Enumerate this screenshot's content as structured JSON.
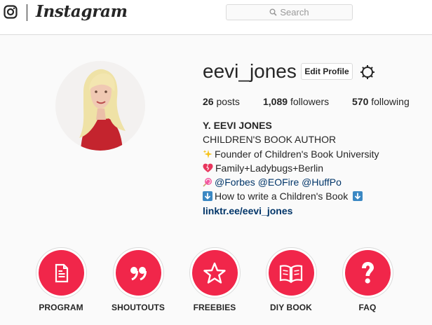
{
  "header": {
    "brand": "Instagram",
    "search_placeholder": "Search"
  },
  "profile": {
    "username": "eevi_jones",
    "edit_label": "Edit Profile",
    "posts_count": "26",
    "posts_label": "posts",
    "followers_count": "1,089",
    "followers_label": "followers",
    "following_count": "570",
    "following_label": "following"
  },
  "bio": {
    "name": "Y. EEVI JONES",
    "line1": "CHILDREN'S BOOK AUTHOR",
    "line2": "Founder of Children's Book University",
    "line3": "Family+Ladybugs+Berlin",
    "mention1": "@Forbes",
    "mention2": "@EOFire",
    "mention3": "@HuffPo",
    "line5": "How to write a Children's Book",
    "link": "linktr.ee/eevi_jones",
    "emoji": [
      "sparkles-icon",
      "sparkling-heart-icon",
      "lollipop-icon",
      "down-arrow-icon"
    ]
  },
  "highlights": [
    {
      "label": "PROGRAM",
      "icon": "document-icon"
    },
    {
      "label": "SHOUTOUTS",
      "icon": "quote-icon"
    },
    {
      "label": "FREEBIES",
      "icon": "star-icon"
    },
    {
      "label": "DIY BOOK",
      "icon": "open-book-icon"
    },
    {
      "label": "FAQ",
      "icon": "question-icon"
    }
  ],
  "colors": {
    "highlight_red": "#f1264a",
    "link_blue": "#003569",
    "text": "#262626",
    "border": "#dbdbdb"
  }
}
